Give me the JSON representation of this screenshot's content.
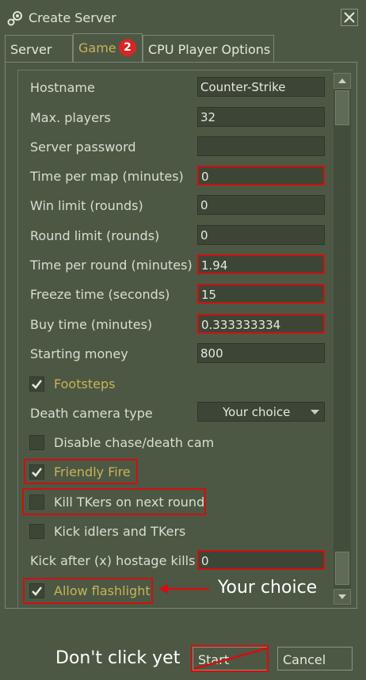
{
  "window": {
    "title": "Create Server",
    "icon": "steam-icon",
    "close_icon": "close-icon"
  },
  "tabs": [
    {
      "label": "Server",
      "active": false
    },
    {
      "label": "Game",
      "active": true,
      "badge": "2"
    },
    {
      "label": "CPU Player Options",
      "active": false
    }
  ],
  "fields": {
    "hostname": {
      "label": "Hostname",
      "value": "Counter-Strike"
    },
    "max_players": {
      "label": "Max. players",
      "value": "32"
    },
    "server_password": {
      "label": "Server password",
      "value": ""
    },
    "time_per_map": {
      "label": "Time per map (minutes)",
      "value": "0"
    },
    "win_limit": {
      "label": "Win limit (rounds)",
      "value": "0"
    },
    "round_limit": {
      "label": "Round limit (rounds)",
      "value": "0"
    },
    "time_per_round": {
      "label": "Time per round (minutes)",
      "value": "1.94"
    },
    "freeze_time": {
      "label": "Freeze time (seconds)",
      "value": "15"
    },
    "buy_time": {
      "label": "Buy time (minutes)",
      "value": "0.333333334"
    },
    "starting_money": {
      "label": "Starting money",
      "value": "800"
    },
    "kick_after_hostage": {
      "label": "Kick after (x) hostage kills",
      "value": "0"
    }
  },
  "checkboxes": {
    "footsteps": {
      "label": "Footsteps",
      "checked": true
    },
    "disable_chase": {
      "label": "Disable chase/death cam",
      "checked": false
    },
    "friendly_fire": {
      "label": "Friendly Fire",
      "checked": true
    },
    "kill_tkers": {
      "label": "Kill TKers on next round",
      "checked": false
    },
    "kick_idlers": {
      "label": "Kick idlers and TKers",
      "checked": false
    },
    "allow_flashlight": {
      "label": "Allow flashlight",
      "checked": true
    }
  },
  "death_camera": {
    "label": "Death camera type",
    "value": "Your choice"
  },
  "annotations": {
    "your_choice": "Your choice",
    "dont_click": "Don't click yet"
  },
  "buttons": {
    "start": "Start",
    "cancel": "Cancel"
  },
  "colors": {
    "highlight": "#d10f0f",
    "accent": "#c9b356",
    "background": "#4c5844"
  }
}
